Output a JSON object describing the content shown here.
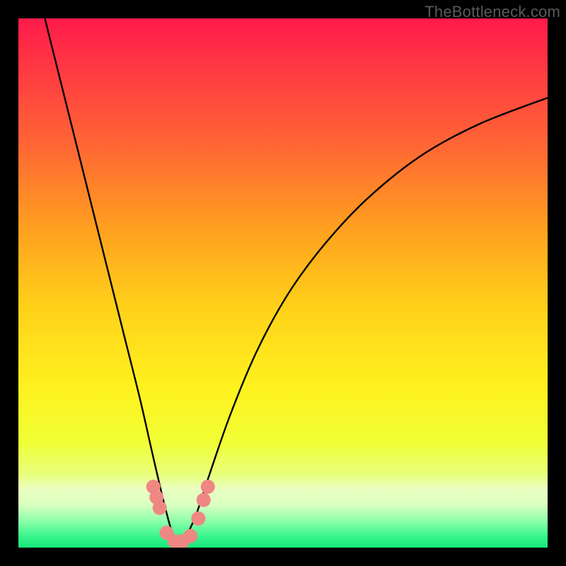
{
  "watermark": "TheBottleneck.com",
  "colors": {
    "frame": "#000000",
    "curve": "#000000",
    "marker_fill": "#ef8783",
    "marker_stroke": "#d46a66",
    "gradient_stops": [
      {
        "offset": 0.0,
        "color": "#ff1b4b"
      },
      {
        "offset": 0.1,
        "color": "#ff3a42"
      },
      {
        "offset": 0.25,
        "color": "#ff6a33"
      },
      {
        "offset": 0.4,
        "color": "#ffa11f"
      },
      {
        "offset": 0.55,
        "color": "#ffd21a"
      },
      {
        "offset": 0.7,
        "color": "#fff21f"
      },
      {
        "offset": 0.8,
        "color": "#f0ff35"
      },
      {
        "offset": 0.86,
        "color": "#e8ff7a"
      },
      {
        "offset": 0.89,
        "color": "#eaffc2"
      },
      {
        "offset": 0.92,
        "color": "#d9ffbf"
      },
      {
        "offset": 0.95,
        "color": "#8cffab"
      },
      {
        "offset": 0.98,
        "color": "#36f48b"
      },
      {
        "offset": 1.0,
        "color": "#17e67a"
      }
    ]
  },
  "chart_data": {
    "type": "line",
    "title": "",
    "xlabel": "",
    "ylabel": "",
    "xlim": [
      0,
      1
    ],
    "ylim": [
      0,
      1
    ],
    "x_min_point": 0.3,
    "series": [
      {
        "name": "bottleneck-curve",
        "x": [
          0.05,
          0.08,
          0.11,
          0.14,
          0.17,
          0.2,
          0.23,
          0.255,
          0.275,
          0.29,
          0.3,
          0.315,
          0.335,
          0.36,
          0.4,
          0.45,
          0.51,
          0.58,
          0.66,
          0.76,
          0.87,
          1.0
        ],
        "y": [
          1.0,
          0.88,
          0.76,
          0.64,
          0.52,
          0.4,
          0.28,
          0.17,
          0.085,
          0.03,
          0.01,
          0.02,
          0.06,
          0.135,
          0.25,
          0.37,
          0.48,
          0.575,
          0.66,
          0.74,
          0.8,
          0.85
        ]
      }
    ],
    "markers": {
      "name": "highlighted-points",
      "x": [
        0.255,
        0.261,
        0.267,
        0.28,
        0.295,
        0.31,
        0.325,
        0.34,
        0.35,
        0.358
      ],
      "y": [
        0.115,
        0.095,
        0.075,
        0.028,
        0.012,
        0.012,
        0.022,
        0.055,
        0.09,
        0.115
      ]
    }
  }
}
